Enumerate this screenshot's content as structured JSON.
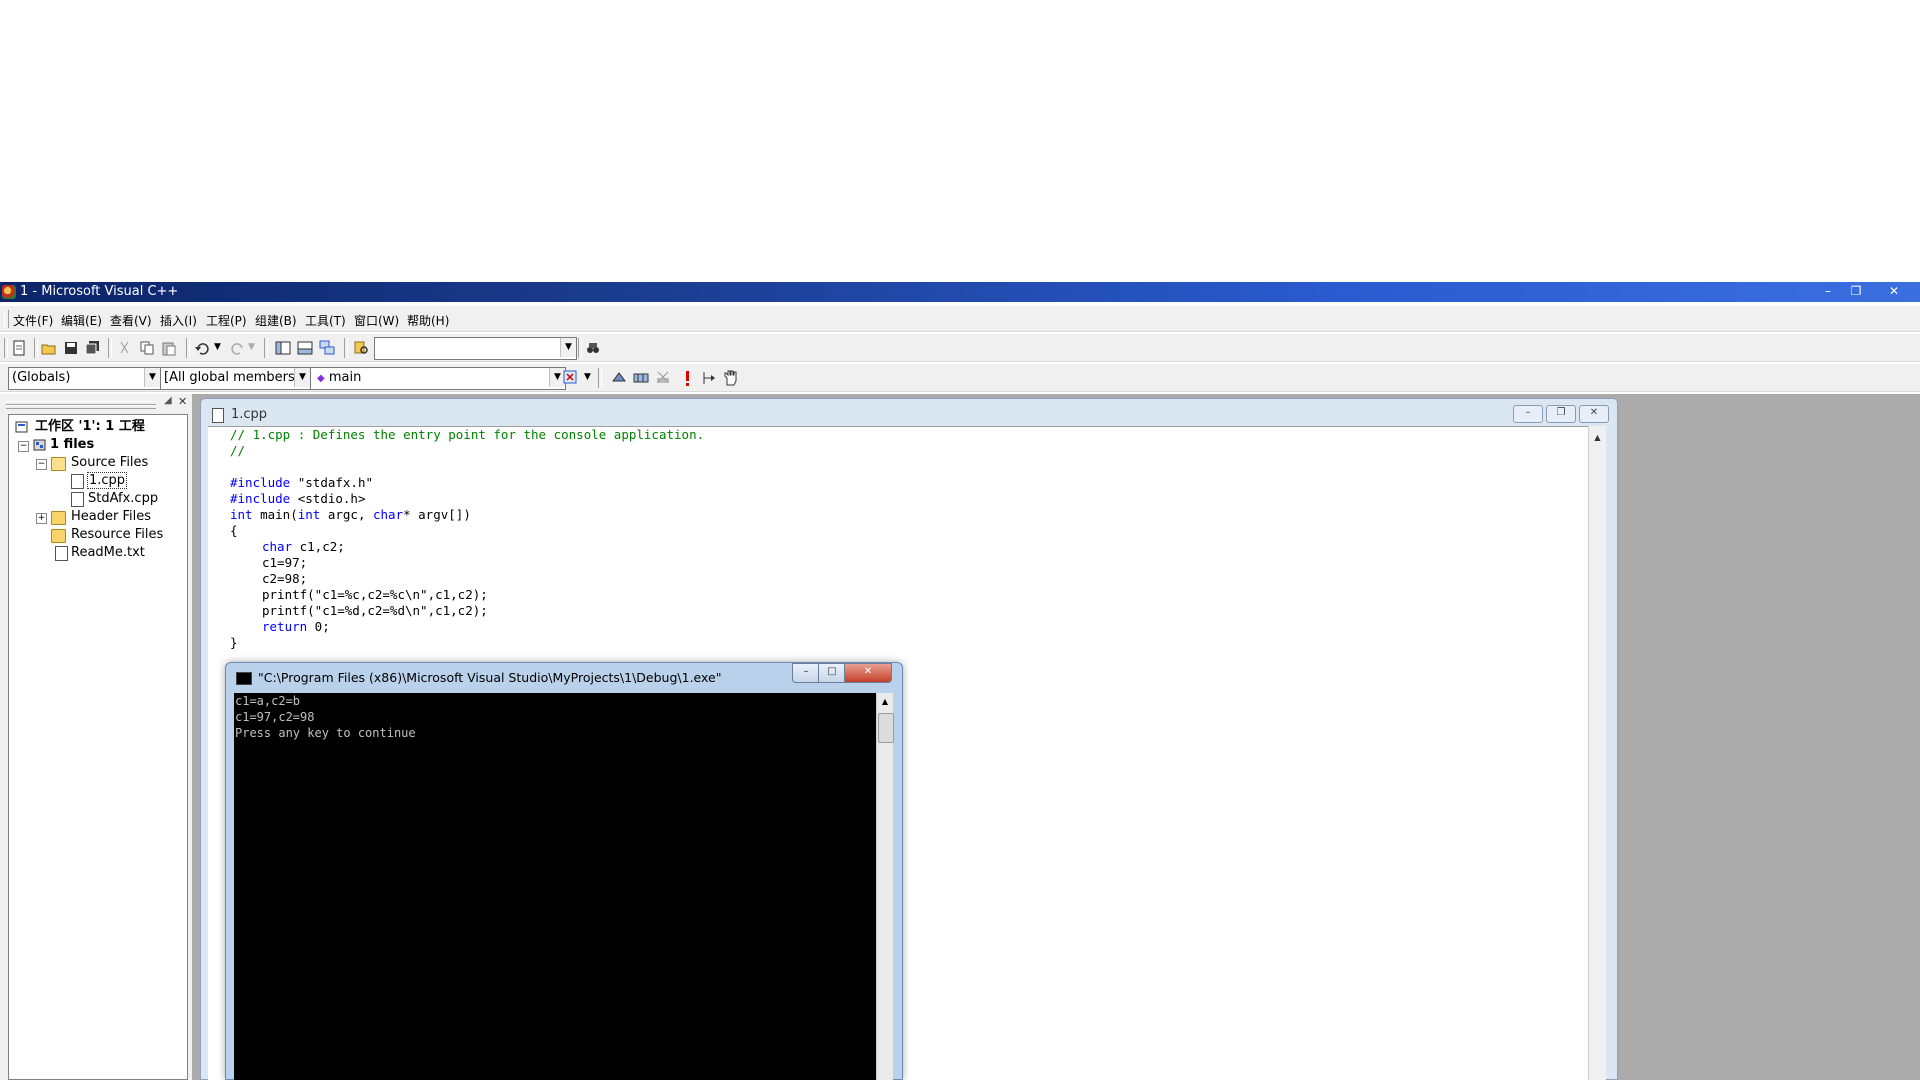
{
  "app": {
    "title": "1 - Microsoft Visual C++",
    "window_buttons": {
      "minimize": "–",
      "restore": "❐",
      "close": "✕"
    }
  },
  "menu": {
    "items": [
      "文件(F)",
      "编辑(E)",
      "查看(V)",
      "插入(I)",
      "工程(P)",
      "组建(B)",
      "工具(T)",
      "窗口(W)",
      "帮助(H)"
    ]
  },
  "toolbar": {
    "find_combo_value": "",
    "scope_combo": "(Globals)",
    "members_combo": "[All global members",
    "function_combo": "main"
  },
  "workspace": {
    "root": "工作区 '1': 1 工程",
    "project": "1 files",
    "source_folder": "Source Files",
    "source_files": [
      "1.cpp",
      "StdAfx.cpp"
    ],
    "header_folder": "Header Files",
    "resource_folder": "Resource Files",
    "readme": "ReadMe.txt"
  },
  "editor": {
    "tab_title": "1.cpp",
    "code": {
      "comment1": "// 1.cpp : Defines the entry point for the console application.",
      "comment2": "//",
      "include1_kw": "#include",
      "include1_rest": " \"stdafx.h\"",
      "include2_kw": "#include",
      "include2_rest": " <stdio.h>",
      "main_kw1": "int",
      "main_mid1": " main(",
      "main_kw2": "int",
      "main_mid2": " argc, ",
      "main_kw3": "char",
      "main_rest": "* argv[])",
      "open_brace": "{",
      "decl_kw": "char",
      "decl_rest": " c1,c2;",
      "assign1": "c1=97;",
      "assign2": "c2=98;",
      "printf1": "printf(\"c1=%c,c2=%c\\n\",c1,c2);",
      "printf2": "printf(\"c1=%d,c2=%d\\n\",c1,c2);",
      "return_kw": "return",
      "return_rest": " 0;",
      "close_brace": "}"
    }
  },
  "console": {
    "title": "\"C:\\Program Files (x86)\\Microsoft Visual Studio\\MyProjects\\1\\Debug\\1.exe\"",
    "lines": [
      "c1=a,c2=b",
      "c1=97,c2=98",
      "Press any key to continue"
    ]
  }
}
